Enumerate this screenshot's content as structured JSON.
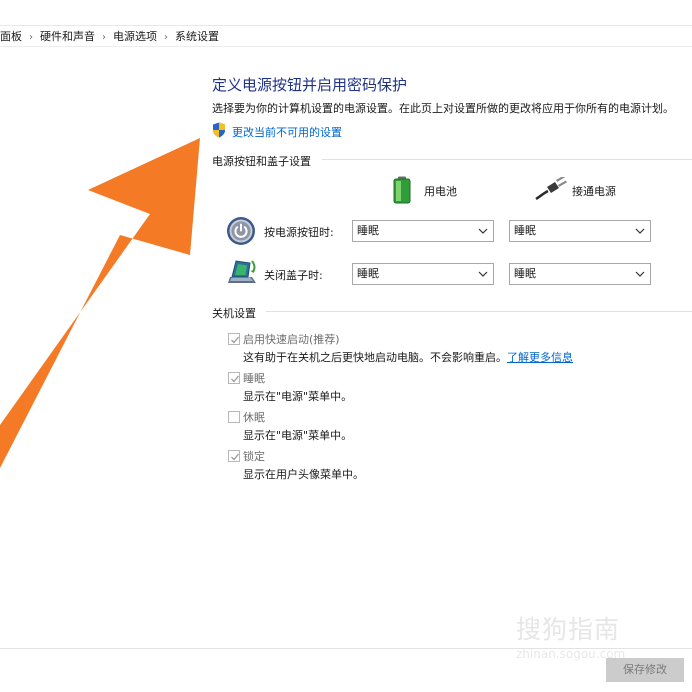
{
  "breadcrumb": {
    "items": [
      "面板",
      "硬件和声音",
      "电源选项",
      "系统设置"
    ],
    "separator": "›"
  },
  "header": {
    "title": "定义电源按钮并启用密码保护",
    "description": "选择要为你的计算机设置的电源设置。在此页上对设置所做的更改将应用于你所有的电源计划。",
    "uac_link": "更改当前不可用的设置"
  },
  "power_buttons": {
    "section_title": "电源按钮和盖子设置",
    "col_battery": "用电池",
    "col_plugged": "接通电源",
    "rows": [
      {
        "label": "按电源按钮时:",
        "battery": "睡眠",
        "plugged": "睡眠"
      },
      {
        "label": "关闭盖子时:",
        "battery": "睡眠",
        "plugged": "睡眠"
      }
    ]
  },
  "shutdown": {
    "section_title": "关机设置",
    "options": [
      {
        "label": "启用快速启动(推荐)",
        "checked": true,
        "desc": "这有助于在关机之后更快地启动电脑。不会影响重启。",
        "link": "了解更多信息"
      },
      {
        "label": "睡眠",
        "checked": true,
        "desc": "显示在\"电源\"菜单中。"
      },
      {
        "label": "休眠",
        "checked": false,
        "desc": "显示在\"电源\"菜单中。"
      },
      {
        "label": "锁定",
        "checked": true,
        "desc": "显示在用户头像菜单中。"
      }
    ]
  },
  "footer": {
    "save_label": "保存修改"
  },
  "watermark": {
    "brand": "搜狗指南",
    "url": "zhinan.sogou.com"
  },
  "colors": {
    "arrow": "#f47a26",
    "title": "#1e3287",
    "link": "#0066cc"
  },
  "icons": {
    "shield": "uac-shield-icon",
    "battery": "battery-icon",
    "plug": "power-plug-icon",
    "power": "power-button-icon",
    "lid": "laptop-lid-icon",
    "arrow": "orange-arrow-annotation"
  }
}
